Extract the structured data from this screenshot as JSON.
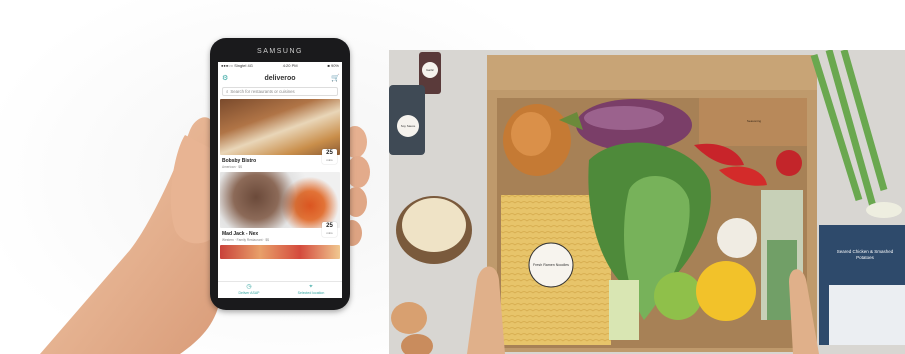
{
  "phone": {
    "brand": "SAMSUNG",
    "status": {
      "carrier": "●●●○○ Singtel 4G",
      "time": "4:20 PM",
      "battery": "■ 90%"
    },
    "app_title": "deliveroo",
    "search_placeholder": "Search for restaurants or cuisines",
    "restaurants": [
      {
        "name": "Bobsby Bistro",
        "subtitle": "American · $$",
        "eta": "25",
        "eta_unit": "mins"
      },
      {
        "name": "Mad Jack - Nex",
        "subtitle": "Western · Family Restaurant · $$",
        "eta": "25",
        "eta_unit": "mins"
      }
    ],
    "tabs": [
      {
        "icon": "clock-icon",
        "label": "Deliver ASAP"
      },
      {
        "icon": "pin-icon",
        "label": "Selected location"
      }
    ]
  },
  "meal_kit": {
    "bottle_labels": [
      "Garlic",
      "Soy Sauce"
    ],
    "bag_labels": [
      "Fresh Ramen Noodles",
      "Seasoning"
    ],
    "card_title": "Seared Chicken & Smashed Potatoes"
  },
  "colors": {
    "accent": "#32a5a0",
    "box": "#c9a77a",
    "table": "#d9d7d3"
  }
}
